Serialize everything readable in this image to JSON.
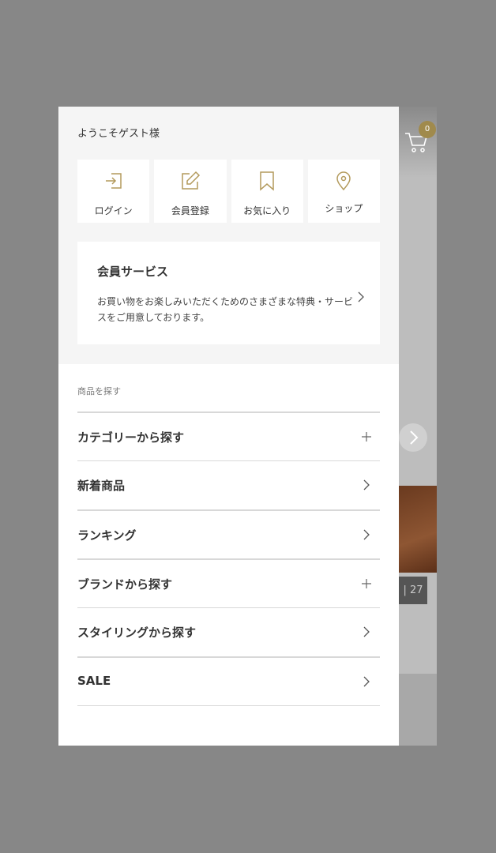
{
  "background": {
    "cart_badge": "0",
    "slide_count": "| 27"
  },
  "drawer": {
    "welcome": "ようこそゲスト様",
    "quick_links": [
      {
        "label": "ログイン",
        "icon": "login-icon"
      },
      {
        "label": "会員登録",
        "icon": "edit-icon"
      },
      {
        "label": "お気に入り",
        "icon": "bookmark-icon"
      },
      {
        "label": "ショップ",
        "icon": "map-pin-icon"
      }
    ],
    "member_service": {
      "title": "会員サービス",
      "description": "お買い物をお楽しみいただくためのさまざまな特典・サービスをご用意しております。"
    },
    "section_label": "商品を探す",
    "menu": [
      {
        "label": "カテゴリーから探す",
        "icon": "plus-icon"
      },
      {
        "label": "新着商品",
        "icon": "chevron-right-icon"
      },
      {
        "label": "ランキング",
        "icon": "chevron-right-icon"
      },
      {
        "label": "ブランドから探す",
        "icon": "plus-icon"
      },
      {
        "label": "スタイリングから探す",
        "icon": "chevron-right-icon"
      },
      {
        "label": "SALE",
        "icon": "chevron-right-icon"
      }
    ]
  },
  "colors": {
    "accent_gold": "#b39a5c",
    "overlay": "#878787"
  }
}
